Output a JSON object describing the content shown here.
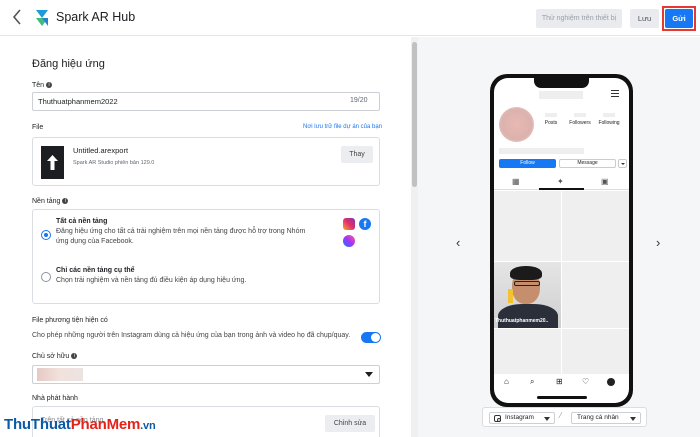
{
  "header": {
    "app_title": "Spark AR Hub",
    "test_button": "Thử nghiệm trên thiết bị",
    "save_button": "Lưu",
    "send_button": "Gửi"
  },
  "form": {
    "section_title": "Đăng hiệu ứng",
    "name_label": "Tên",
    "name_value": "Thuthuatphanmem2022",
    "name_counter": "19/20",
    "file_label": "File",
    "storage_link": "Nơi lưu trữ file dự án của bạn",
    "file_name": "Untitled.arexport",
    "file_version": "Spark AR Studio phiên bản 129.0",
    "replace_button": "Thay",
    "platform_label": "Nền tảng",
    "platform_all_title": "Tất cả nền tảng",
    "platform_all_desc": "Đăng hiệu ứng cho tất cả trải nghiệm trên mọi nền tảng được hỗ trợ trong Nhóm ứng dụng của Facebook.",
    "platform_specific_title": "Chỉ các nền tảng cụ thể",
    "platform_specific_desc": "Chọn trải nghiệm và nền tảng đủ điều kiện áp dụng hiệu ứng.",
    "media_label": "File phương tiện hiện có",
    "media_desc": "Cho phép những người trên Instagram dùng cả hiệu ứng của bạn trong ảnh và video họ đã chụp/quay.",
    "media_toggle_on": true,
    "owner_label": "Chủ sở hữu",
    "publisher_label": "Nhà phát hành",
    "publisher_partial_text": "Trên tất cả nền tảng",
    "edit_button": "Chỉnh sửa"
  },
  "preview": {
    "stats": [
      "Posts",
      "Followers",
      "Following"
    ],
    "follow_button": "Follow",
    "message_button": "Message",
    "photo_caption": "Thuthuatphanmem20..",
    "platform_select": "Instagram",
    "page_select": "Trang cá nhân",
    "nav_prev": "‹",
    "nav_next": "›"
  },
  "watermark": {
    "part1": "ThuThuat",
    "part2": "PhanMem",
    "part3": ".vn"
  },
  "colors": {
    "accent": "#1877f2",
    "highlight": "#e53935"
  },
  "icons": [
    "chevron-left-icon",
    "spark-ar-logo-icon",
    "info-icon",
    "upload-arrow-icon",
    "instagram-icon",
    "facebook-icon",
    "messenger-icon",
    "caret-down-icon",
    "grid-icon",
    "effects-icon",
    "tagged-icon",
    "home-icon",
    "search-icon",
    "add-icon",
    "heart-icon",
    "profile-icon"
  ]
}
